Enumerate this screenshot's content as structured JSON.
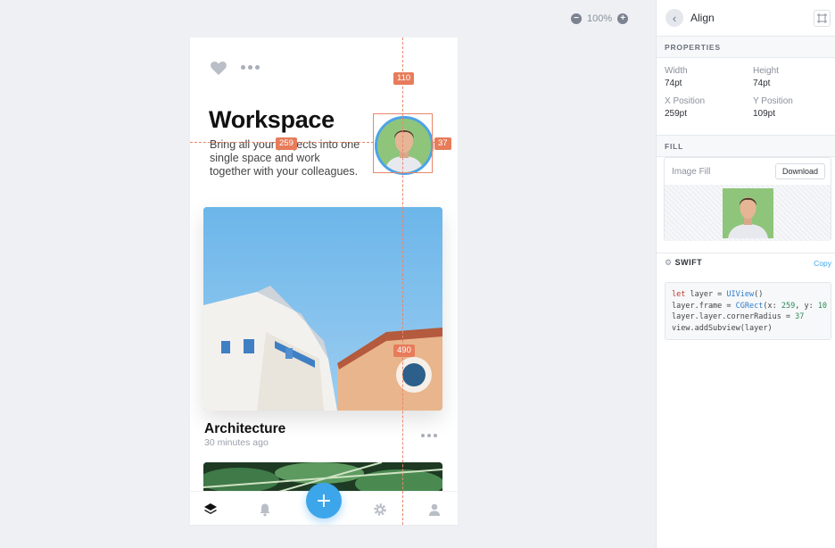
{
  "zoom": {
    "level": "100%"
  },
  "app": {
    "title": "Workspace",
    "description": "Bring all your projects into one single space and work together with your colleagues.",
    "card": {
      "title": "Architecture",
      "subtitle": "30 minutes ago"
    }
  },
  "measurements": {
    "top": "110",
    "left": "259",
    "right": "37",
    "bottom": "490"
  },
  "panel": {
    "header_title": "Align",
    "properties_section": "PROPERTIES",
    "width_label": "Width",
    "width_value": "74pt",
    "height_label": "Height",
    "height_value": "74pt",
    "x_label": "X Position",
    "x_value": "259pt",
    "y_label": "Y Position",
    "y_value": "109pt",
    "fill_section": "FILL",
    "image_fill_label": "Image Fill",
    "download_label": "Download",
    "swift_section": "SWIFT",
    "copy_label": "Copy",
    "code": {
      "l1_kw": "let",
      "l1_a": " layer = ",
      "l1_ty": "UIView",
      "l1_b": "()",
      "l2_a": "layer.frame = ",
      "l2_ty": "CGRect",
      "l2_b": "(x: ",
      "l2_n1": "259",
      "l2_c": ", y: ",
      "l2_n2": "10",
      "l3_a": "layer.layer.cornerRadius = ",
      "l3_n": "37",
      "l4": "view.addSubview(layer)"
    }
  },
  "colors": {
    "accent": "#3da6ea",
    "guide": "#e77c5b",
    "avatar_bg": "#8ec57b"
  },
  "icons": [
    "heart-icon",
    "more-icon",
    "layers-icon",
    "bell-icon",
    "plus-icon",
    "gear-icon",
    "user-icon",
    "back-icon",
    "frame-icon",
    "swift-gear-icon",
    "zoom-out-icon",
    "zoom-in-icon"
  ]
}
